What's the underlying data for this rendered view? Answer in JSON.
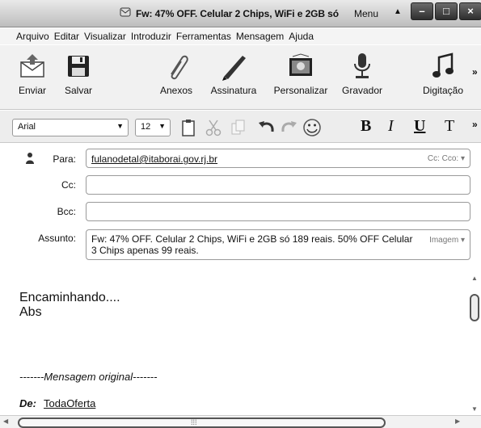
{
  "window": {
    "title": "Fw: 47% OFF. Celular 2 Chips, WiFi e 2GB só",
    "title_menu": "Menu",
    "title_arrow": "▲",
    "controls": {
      "minimize": "–",
      "maximize": "□",
      "close": "×"
    }
  },
  "menubar": [
    {
      "label": "Arquivo"
    },
    {
      "label": "Editar"
    },
    {
      "label": "Visualizar"
    },
    {
      "label": "Introduzir"
    },
    {
      "label": "Ferramentas"
    },
    {
      "label": "Mensagem"
    },
    {
      "label": "Ajuda"
    }
  ],
  "toolbar": {
    "send": "Enviar",
    "save": "Salvar",
    "attachments": "Anexos",
    "signature": "Assinatura",
    "customize": "Personalizar",
    "recorder": "Gravador",
    "dictation": "Digitação",
    "more": "»"
  },
  "format": {
    "font": "Arial",
    "size": "12",
    "bold": "B",
    "italic": "I",
    "underline": "U",
    "text_style": "T",
    "more": "»"
  },
  "headers": {
    "to_label": "Para:",
    "to_value": "fulanodetal@itaborai.gov.rj.br",
    "cc_bcc_toggle": "Cc: Cco: ▾",
    "cc_label": "Cc:",
    "cc_value": "",
    "bcc_label": "Bcc:",
    "bcc_value": "",
    "subject_label": "Assunto:",
    "subject_value": "Fw: 47% OFF. Celular 2 Chips, WiFi e 2GB só 189 reais. 50% OFF Celular 3 Chips apenas 99 reais.",
    "image_toggle": "Imagem ▾"
  },
  "body": {
    "line1": "Encaminhando....",
    "line2": "Abs",
    "separator": "-------Mensagem original-------",
    "from_label": "De:",
    "from_value": "TodaOferta"
  },
  "scrollbar": {
    "up": "▲",
    "down": "▼",
    "left": "◀",
    "right": "▶",
    "grip": "⁞⁞⁞"
  }
}
